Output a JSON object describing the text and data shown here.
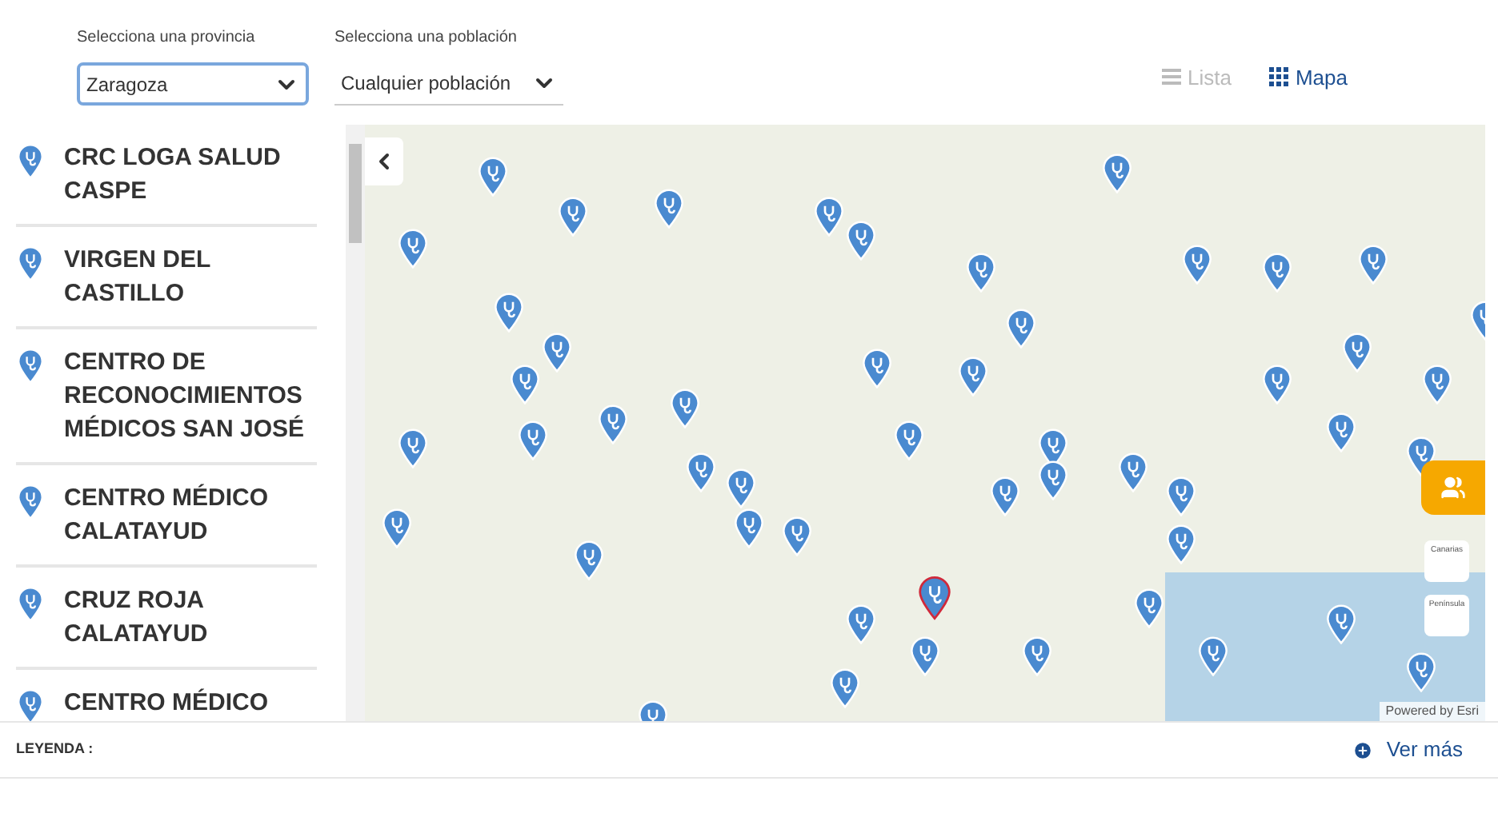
{
  "filters": [
    {
      "label": "Selecciona una provincia",
      "value": "Zaragoza",
      "focused": true
    },
    {
      "label": "Selecciona una población",
      "value": "Cualquier población",
      "focused": false
    }
  ],
  "view_toggle": [
    {
      "label": "Lista",
      "selected": false,
      "kind": "list"
    },
    {
      "label": "Mapa",
      "selected": true,
      "kind": "grid"
    }
  ],
  "centers": [
    {
      "name": "CRC LOGA SALUD CASPE"
    },
    {
      "name": "VIRGEN DEL CASTILLO"
    },
    {
      "name": "CENTRO DE RECONOCIMIENTOS MÉDICOS SAN JOSÉ"
    },
    {
      "name": "CENTRO MÉDICO CALATAYUD"
    },
    {
      "name": "CRUZ ROJA CALATAYUD"
    },
    {
      "name": "CENTRO MÉDICO"
    }
  ],
  "map": {
    "region_buttons": [
      "Canarias",
      "Península"
    ],
    "attribution": "Powered by Esri"
  },
  "legend": {
    "label": "LEYENDA :",
    "more": "Ver más"
  }
}
